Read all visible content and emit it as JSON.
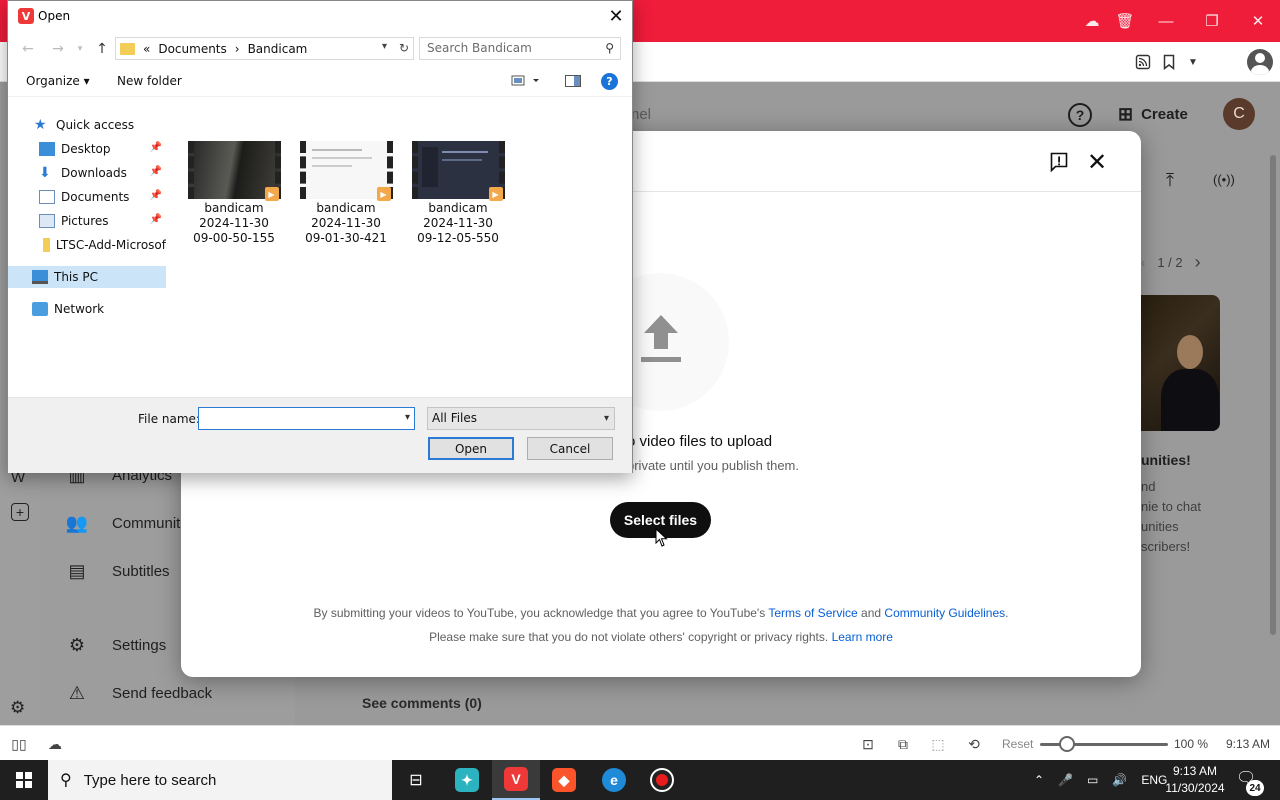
{
  "browser": {
    "accent": "#ef1c3a"
  },
  "yt_background": {
    "search_partial": "nel",
    "create_label": "Create",
    "avatar_letter": "C",
    "pager": "1 / 2",
    "sidebar": [
      {
        "label": "Analytics",
        "icon": "analytics-icon"
      },
      {
        "label": "Communit",
        "icon": "community-icon"
      },
      {
        "label": "Subtitles",
        "icon": "subtitles-icon"
      },
      {
        "label": "Settings",
        "icon": "gear-icon"
      },
      {
        "label": "Send feedback",
        "icon": "feedback-icon"
      }
    ],
    "promo": {
      "headline": "unities!",
      "line1": "nd",
      "line2": "nie to chat",
      "line3": "unities",
      "line4": "scribers!"
    },
    "see_comments": "See comments (0)"
  },
  "upload_modal": {
    "drag_text": "o video files to upload",
    "private_text": "private until you publish them.",
    "select_files": "Select files",
    "legal1_pre": "By submitting your videos to YouTube, you acknowledge that you agree to YouTube's ",
    "legal1_tos": "Terms of Service",
    "legal1_and": " and ",
    "legal1_cg": "Community Guidelines",
    "legal1_end": ".",
    "legal2_pre": "Please make sure that you do not violate others' copyright or privacy rights. ",
    "legal2_link": "Learn more"
  },
  "open_dialog": {
    "title": "Open",
    "path": {
      "prefix": "«",
      "segment1": "Documents",
      "sep": "›",
      "segment2": "Bandicam"
    },
    "search_placeholder": "Search Bandicam",
    "toolbar": {
      "organize": "Organize ▾",
      "new_folder": "New folder"
    },
    "nav": [
      {
        "label": "Quick access",
        "icon": "star-icon"
      },
      {
        "label": "Desktop",
        "icon": "desktop-icon",
        "pinned": true
      },
      {
        "label": "Downloads",
        "icon": "download-icon",
        "pinned": true
      },
      {
        "label": "Documents",
        "icon": "documents-icon",
        "pinned": true
      },
      {
        "label": "Pictures",
        "icon": "pictures-icon",
        "pinned": true
      },
      {
        "label": "LTSC-Add-Microsof",
        "icon": "folder-icon"
      },
      {
        "label": "This PC",
        "icon": "computer-icon",
        "selected": true
      },
      {
        "label": "Network",
        "icon": "network-icon"
      }
    ],
    "files": [
      {
        "name": "bandicam",
        "date": "2024-11-30",
        "time": "09-00-50-155"
      },
      {
        "name": "bandicam",
        "date": "2024-11-30",
        "time": "09-01-30-421"
      },
      {
        "name": "bandicam",
        "date": "2024-11-30",
        "time": "09-12-05-550"
      }
    ],
    "file_name_label": "File name:",
    "file_name_value": "",
    "file_type": "All Files",
    "open_btn": "Open",
    "cancel_btn": "Cancel"
  },
  "statusbar": {
    "reset": "Reset",
    "zoom": "100 %",
    "time": "9:13 AM",
    "zoom_fraction": 0.15
  },
  "taskbar": {
    "search_placeholder": "Type here to search",
    "lang": "ENG",
    "clock_time": "9:13 AM",
    "clock_date": "11/30/2024",
    "notif_count": "24"
  }
}
